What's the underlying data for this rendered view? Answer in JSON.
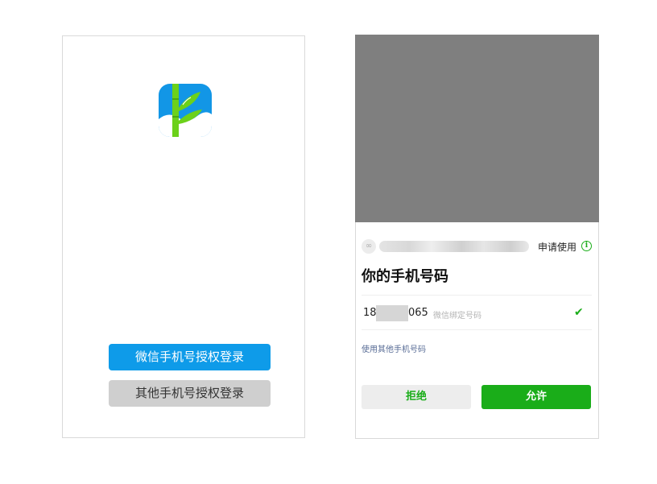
{
  "login_screen": {
    "logo_icon": "bamboo-logo-icon",
    "wechat_login_label": "微信手机号授权登录",
    "other_login_label": "其他手机号授权登录"
  },
  "auth_sheet": {
    "apply_label": "申请使用",
    "info_icon": "info-icon",
    "title": "你的手机号码",
    "phone_prefix": "18",
    "phone_suffix": "065",
    "phone_hint": "微信绑定号码",
    "check_icon": "check-icon",
    "other_phone_link": "使用其他手机号码",
    "reject_label": "拒绝",
    "allow_label": "允许"
  },
  "colors": {
    "wechat_blue": "#0e9be9",
    "wechat_green": "#1aad19",
    "overlay_gray": "#7f7f7f",
    "link_blue": "#576b95"
  }
}
